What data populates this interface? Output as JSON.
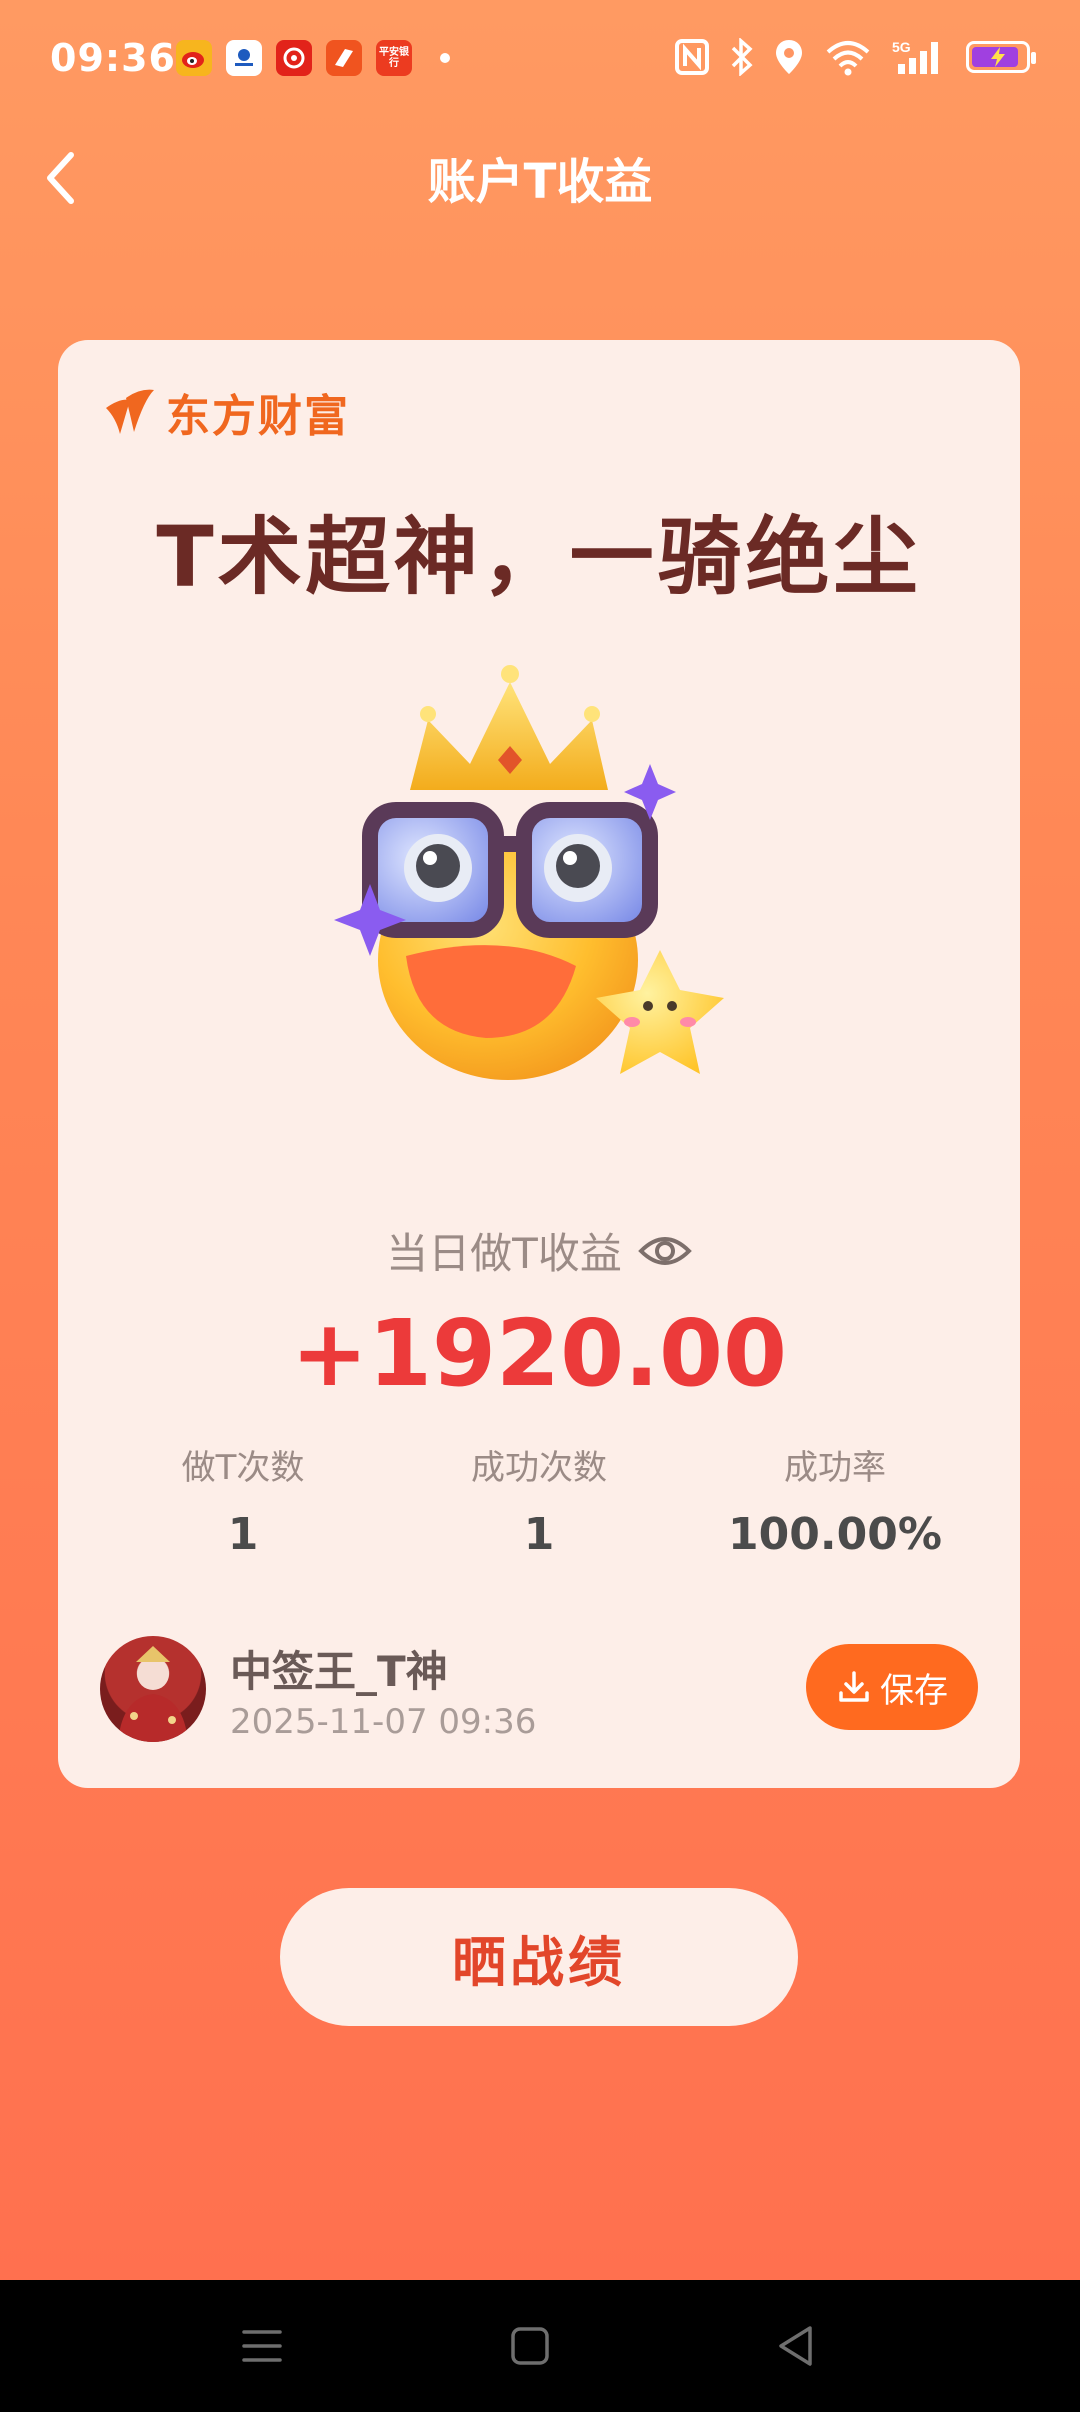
{
  "status_bar": {
    "time": "09:36",
    "apps": [
      {
        "icon": "weibo-icon",
        "color": "#f7b51e",
        "label": ""
      },
      {
        "icon": "news-app-icon",
        "color": "#ffffff",
        "label": ""
      },
      {
        "icon": "netease-music-icon",
        "color": "#e2231a",
        "label": ""
      },
      {
        "icon": "eastmoney-app-icon",
        "color": "#f0541f",
        "label": ""
      },
      {
        "icon": "pingan-bank-icon",
        "color": "#ec3b20",
        "label": "平安银行"
      }
    ],
    "battery_color": "#a040e0"
  },
  "header": {
    "title": "账户T收益"
  },
  "card": {
    "brand": "东方财富",
    "headline": "T术超神，一骑绝尘",
    "metric_label": "当日做T收益",
    "metric_value": "+1920.00",
    "stats": [
      {
        "label": "做T次数",
        "value": "1"
      },
      {
        "label": "成功次数",
        "value": "1"
      },
      {
        "label": "成功率",
        "value": "100.00%"
      }
    ],
    "user": {
      "name": "中签王_T神",
      "timestamp": "2025-11-07 09:36"
    },
    "save_label": "保存"
  },
  "share_button": "晒战绩",
  "colors": {
    "accent": "#ff6a1f",
    "headline": "#6b2a25",
    "profit": "#ec3a3a",
    "card_bg": "#fdeee8"
  }
}
